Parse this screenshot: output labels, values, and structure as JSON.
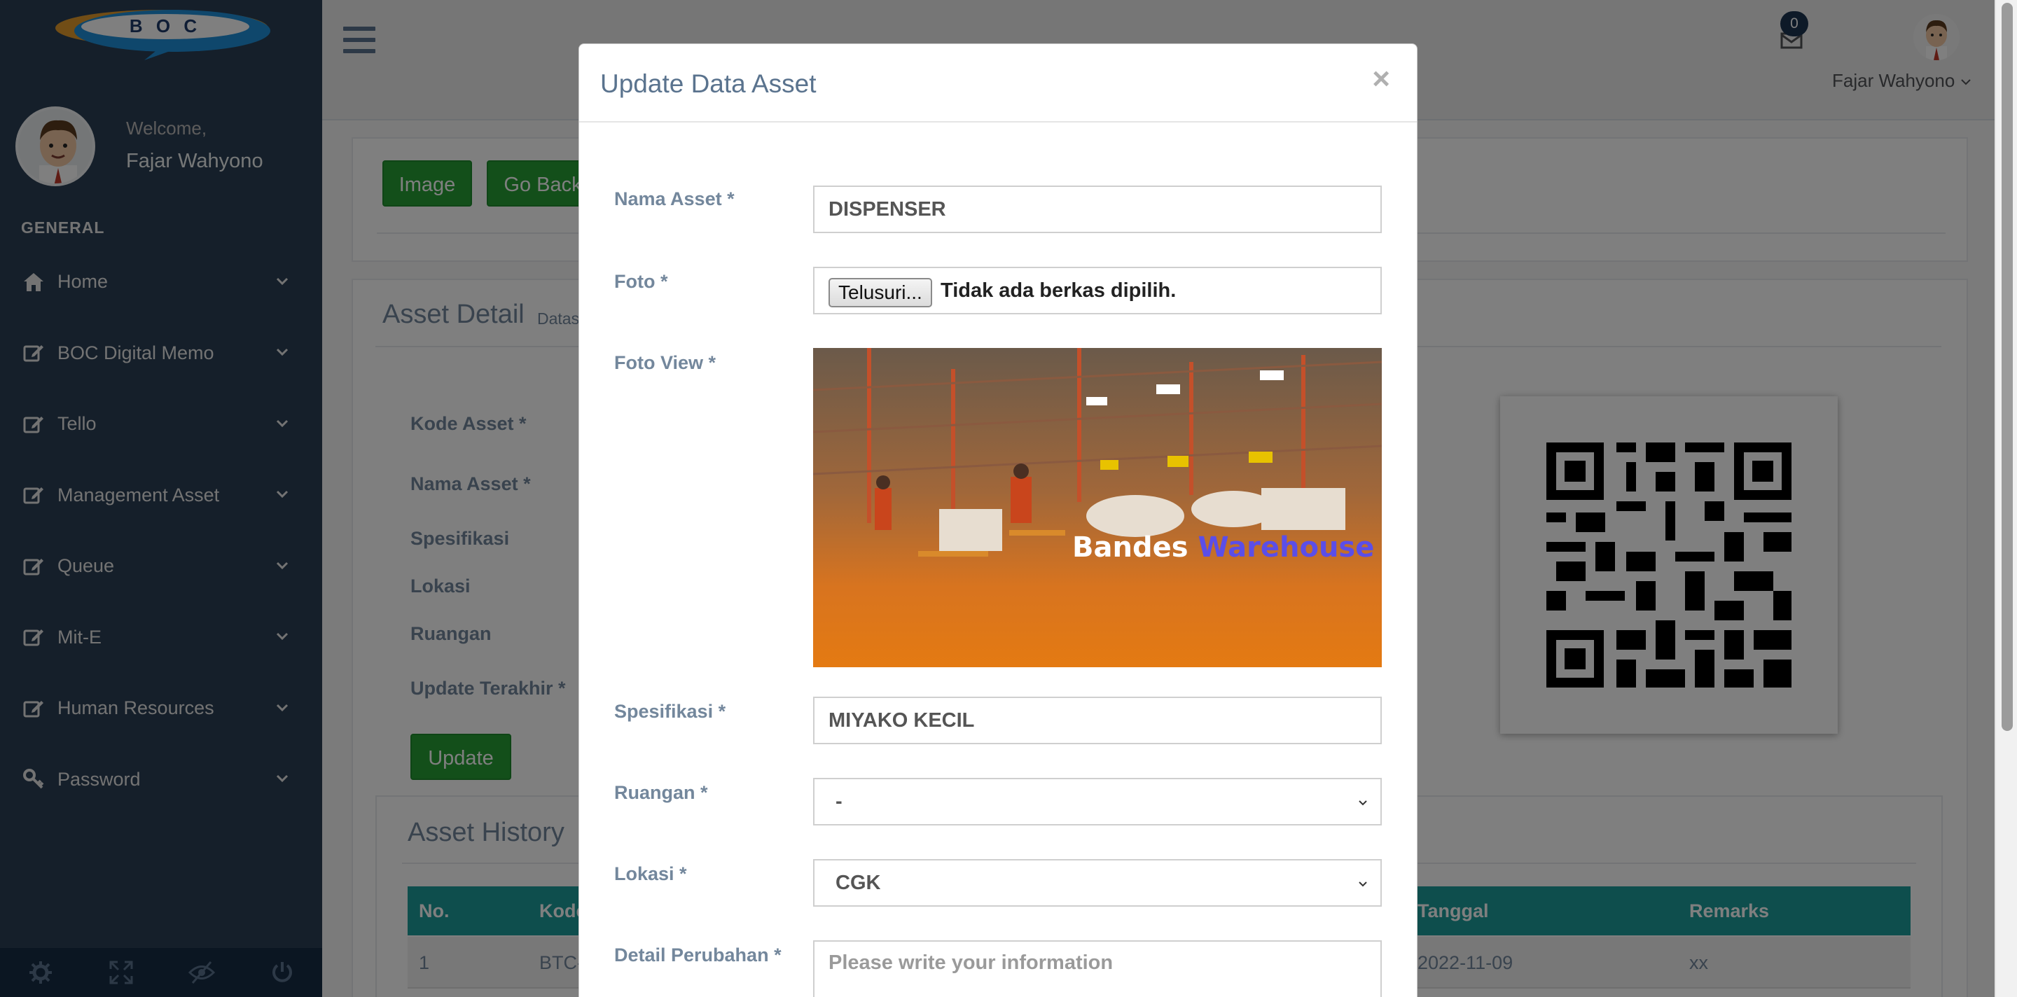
{
  "sidebar": {
    "logo_text": "B O C",
    "welcome": "Welcome,",
    "user_name": "Fajar Wahyono",
    "section": "GENERAL",
    "items": [
      {
        "label": "Home",
        "icon": "home-icon"
      },
      {
        "label": "BOC Digital Memo",
        "icon": "edit-icon"
      },
      {
        "label": "Tello",
        "icon": "edit-icon"
      },
      {
        "label": "Management Asset",
        "icon": "edit-icon"
      },
      {
        "label": "Queue",
        "icon": "edit-icon"
      },
      {
        "label": "Mit-E",
        "icon": "edit-icon"
      },
      {
        "label": "Human Resources",
        "icon": "edit-icon"
      },
      {
        "label": "Password",
        "icon": "key-icon"
      }
    ],
    "footer_icons": [
      "gear-icon",
      "fullscreen-icon",
      "eye-slash-icon",
      "power-icon"
    ]
  },
  "topnav": {
    "mail_count": "0",
    "user_name": "Fajar Wahyono"
  },
  "toolbar": {
    "image_label": "Image",
    "go_back_label": "Go Back"
  },
  "asset_detail": {
    "title": "Asset Detail",
    "subtitle": "Datas",
    "labels": [
      "Kode Asset *",
      "Nama Asset *",
      "Spesifikasi",
      "Lokasi",
      "Ruangan",
      "Update Terakhir *"
    ],
    "update_label": "Update"
  },
  "asset_history": {
    "title": "Asset History",
    "columns": {
      "no": "No.",
      "kode": "Kode",
      "tanggal": "Tanggal",
      "remarks": "Remarks"
    },
    "rows": [
      {
        "no": "1",
        "kode": "BTC-",
        "tanggal": "2022-11-09",
        "remarks": "xx"
      }
    ]
  },
  "modal": {
    "title": "Update Data Asset",
    "close": "×",
    "fields": {
      "nama_label": "Nama Asset *",
      "nama_value": "DISPENSER",
      "foto_label": "Foto *",
      "file_button": "Telusuri...",
      "file_status": "Tidak ada berkas dipilih.",
      "foto_view_label": "Foto View *",
      "photo_caption_1": "Bandes ",
      "photo_caption_2": "Warehouse",
      "spesifikasi_label": "Spesifikasi *",
      "spesifikasi_value": "MIYAKO KECIL",
      "ruangan_label": "Ruangan *",
      "ruangan_value": "-",
      "lokasi_label": "Lokasi *",
      "lokasi_value": "CGK",
      "detail_label": "Detail Perubahan *",
      "detail_placeholder": "Please write your information"
    }
  },
  "colors": {
    "sidebar_bg": "#2a3f54",
    "button_green": "#269f35",
    "table_header": "#1d9d9a"
  }
}
